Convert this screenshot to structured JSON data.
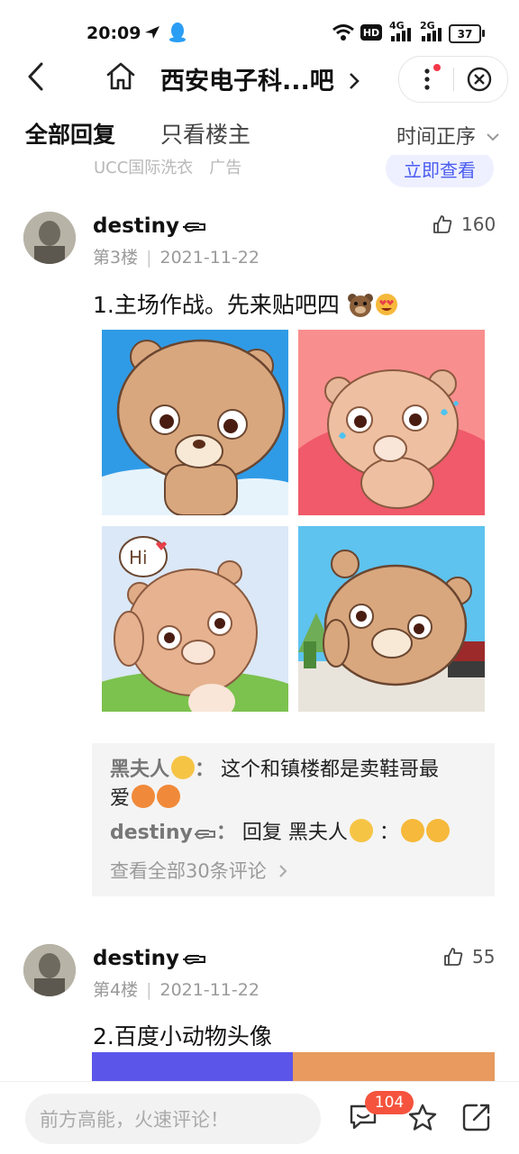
{
  "status_bar": {
    "time": "20:09",
    "hd_label": "HD",
    "net1_label": "4G",
    "net2_label": "2G",
    "battery": "37"
  },
  "nav": {
    "title": "西安电子科...吧"
  },
  "tabs": {
    "all": "全部回复",
    "owner_only": "只看楼主",
    "order": "时间正序"
  },
  "ad": {
    "text": "UCC国际洗衣　广告",
    "button": "立即查看"
  },
  "posts": [
    {
      "username": "destiny",
      "floor": "第3楼",
      "date": "2021-11-22",
      "likes": "160",
      "content": "1.主场作战。先来贴吧四",
      "comments": [
        {
          "author": "黑夫人",
          "sep": "：",
          "text": "这个和镇楼都是卖鞋哥最"
        },
        {
          "cont": "爱"
        },
        {
          "author": "destiny",
          "sep": "：",
          "text": "回复 黑夫人",
          "tail": "："
        }
      ],
      "view_all": "查看全部30条评论"
    },
    {
      "username": "destiny",
      "floor": "第4楼",
      "date": "2021-11-22",
      "likes": "55",
      "content": "2.百度小动物头像"
    }
  ],
  "bottom": {
    "placeholder": "前方高能，火速评论！",
    "badge": "104"
  },
  "colors": {
    "accent": "#4a5cf0",
    "badge": "#f5533d",
    "bear": "#d9a77e"
  }
}
